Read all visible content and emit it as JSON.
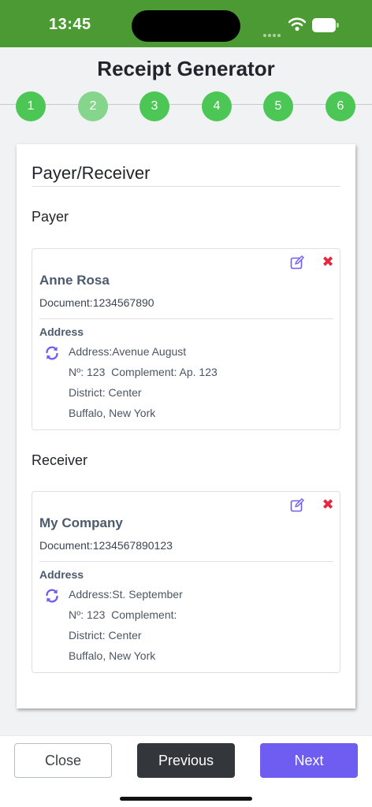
{
  "status_bar": {
    "time": "13:45",
    "icons": [
      "wifi-icon",
      "battery-icon"
    ]
  },
  "app": {
    "title": "Receipt Generator"
  },
  "stepper": {
    "steps": [
      "1",
      "2",
      "3",
      "4",
      "5",
      "6"
    ],
    "active_step": "2",
    "colors": {
      "done": "#4cc755",
      "active": "#86d58c"
    }
  },
  "form": {
    "section_title": "Payer/Receiver",
    "payer": {
      "heading": "Payer",
      "name": "Anne Rosa",
      "document": "Document:1234567890",
      "address_heading": "Address",
      "address_lines": [
        "Address:Avenue August",
        "Nº: 123  Complement: Ap. 123",
        "District: Center",
        "Buffalo, New York"
      ]
    },
    "receiver": {
      "heading": "Receiver",
      "name": "My Company",
      "document": "Document:1234567890123",
      "address_heading": "Address",
      "address_lines": [
        "Address:St. September",
        "Nº: 123  Complement:",
        "District: Center",
        "Buffalo, New York"
      ]
    },
    "icons": {
      "edit": "edit-icon",
      "delete": "delete-icon",
      "refresh": "refresh-icon"
    },
    "colors": {
      "edit": "#6f5cf0",
      "delete": "#e5273f",
      "refresh": "#6f5cf0"
    }
  },
  "footer": {
    "close_label": "Close",
    "previous_label": "Previous",
    "next_label": "Next",
    "colors": {
      "previous": "#33373b",
      "next": "#6f5cf0"
    }
  }
}
